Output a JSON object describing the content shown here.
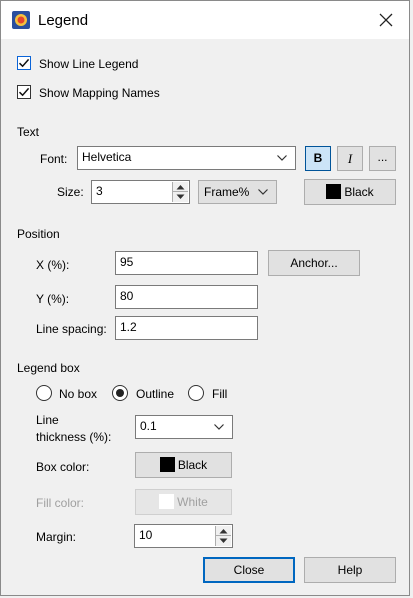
{
  "window": {
    "title": "Legend"
  },
  "show_line_legend": {
    "label": "Show Line Legend",
    "checked": true
  },
  "show_mapping_names": {
    "label": "Show Mapping Names",
    "checked": true
  },
  "text": {
    "section_label": "Text",
    "font_label": "Font:",
    "font_value": "Helvetica",
    "bold_label": "B",
    "bold_active": true,
    "italic_label": "I",
    "more_label": "...",
    "size_label": "Size:",
    "size_value": "3",
    "units_value": "Frame%",
    "color_label": "Black",
    "color": "#000000"
  },
  "position": {
    "section_label": "Position",
    "x_label": "X (%):",
    "x_value": "95",
    "anchor_label": "Anchor...",
    "y_label": "Y (%):",
    "y_value": "80",
    "line_spacing_label": "Line spacing:",
    "line_spacing_value": "1.2"
  },
  "legend_box": {
    "section_label": "Legend box",
    "options": [
      "No box",
      "Outline",
      "Fill"
    ],
    "selected": "Outline",
    "line_thickness_label_1": "Line",
    "line_thickness_label_2": "thickness (%):",
    "line_thickness_value": "0.1",
    "box_color_label": "Box color:",
    "box_color_value": "Black",
    "box_color": "#000000",
    "fill_color_label": "Fill color:",
    "fill_color_value": "White",
    "fill_color": "#ffffff",
    "margin_label": "Margin:",
    "margin_value": "10"
  },
  "buttons": {
    "close": "Close",
    "help": "Help"
  },
  "colors": {
    "accent": "#0067c0",
    "checkbox_border": "#0a64d8"
  }
}
